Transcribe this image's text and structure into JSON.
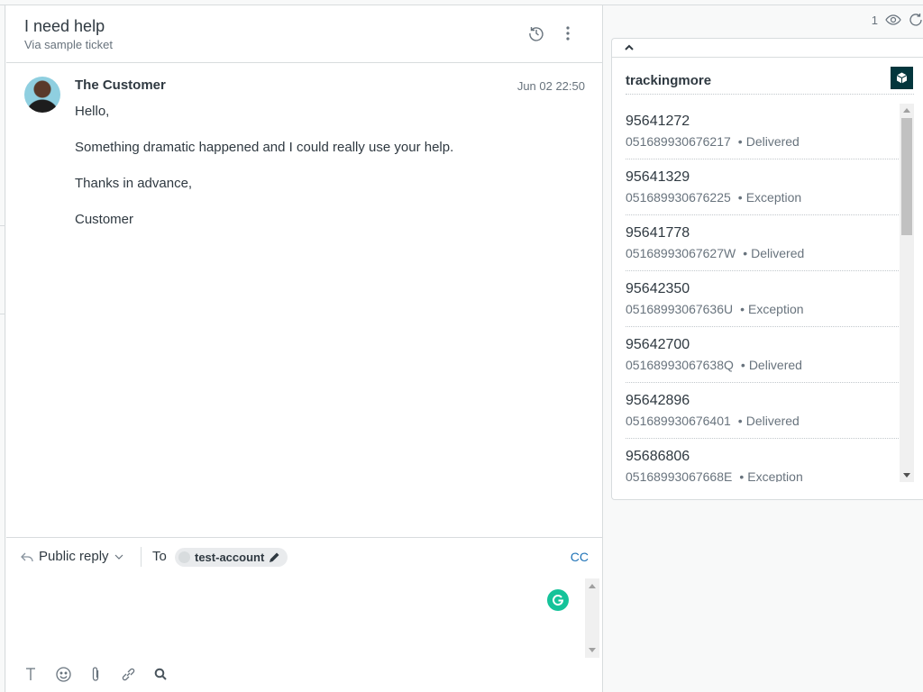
{
  "ticket": {
    "title": "I need help",
    "subtitle": "Via sample ticket"
  },
  "header_icons": [
    "history-icon",
    "more-vertical-icon"
  ],
  "message": {
    "author": "The Customer",
    "timestamp": "Jun 02 22:50",
    "paragraphs": [
      "Hello,",
      "Something dramatic happened and I could really use your help.",
      "Thanks in advance,",
      "Customer"
    ]
  },
  "composer": {
    "reply_type": "Public reply",
    "to_label": "To",
    "recipient": "test-account",
    "cc_label": "CC",
    "toolbar": [
      "text-format-icon",
      "emoji-icon",
      "attachment-icon",
      "link-icon",
      "search-icon"
    ]
  },
  "sidebar": {
    "viewer_count": "1",
    "app": {
      "name": "trackingmore",
      "brand_color": "#03363d",
      "items": [
        {
          "order": "95641272",
          "tracking": "051689930676217",
          "status": "Delivered"
        },
        {
          "order": "95641329",
          "tracking": "051689930676225",
          "status": "Exception"
        },
        {
          "order": "95641778",
          "tracking": "05168993067627W",
          "status": "Delivered"
        },
        {
          "order": "95642350",
          "tracking": "05168993067636U",
          "status": "Exception"
        },
        {
          "order": "95642700",
          "tracking": "05168993067638Q",
          "status": "Delivered"
        },
        {
          "order": "95642896",
          "tracking": "051689930676401",
          "status": "Delivered"
        },
        {
          "order": "95686806",
          "tracking": "05168993067668E",
          "status": "Exception"
        }
      ]
    }
  }
}
